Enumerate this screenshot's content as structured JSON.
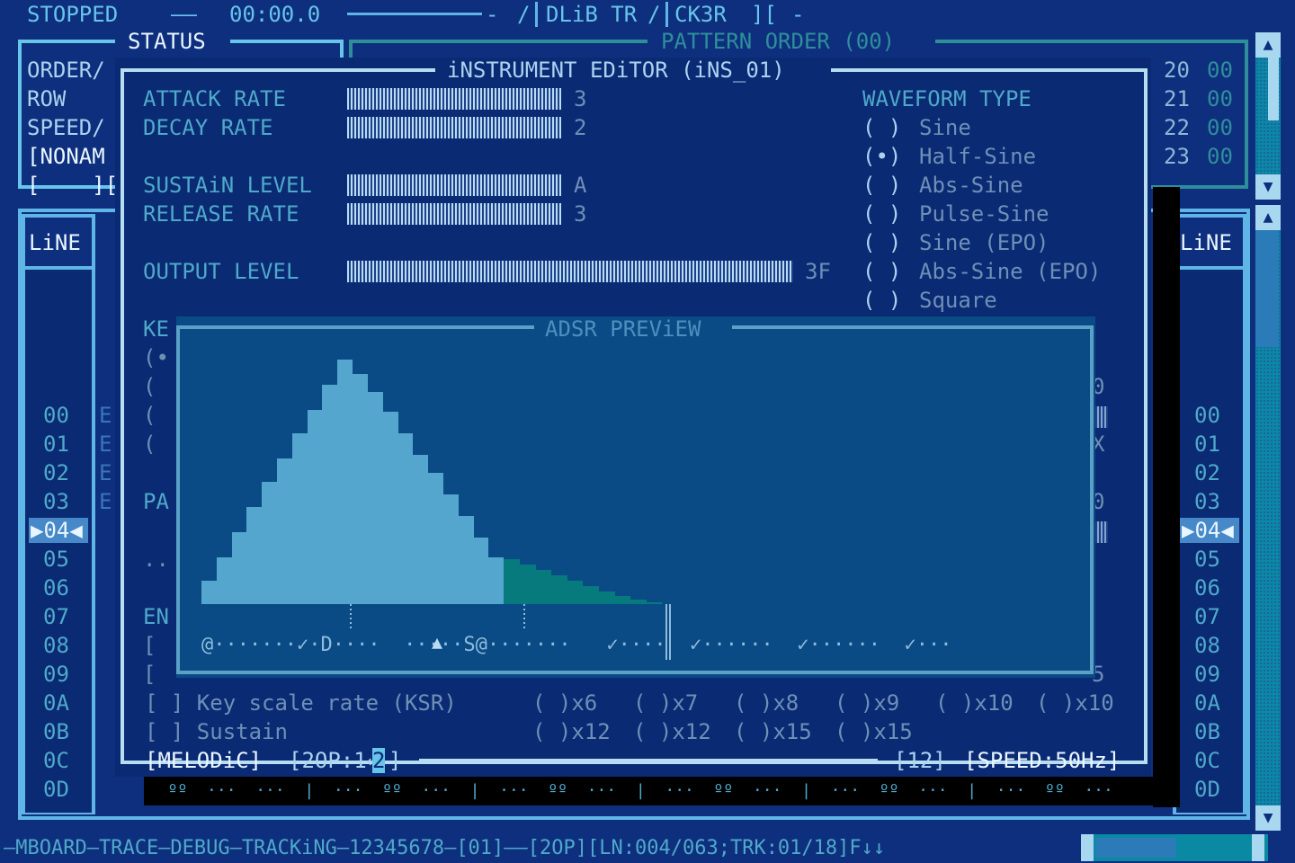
{
  "top_bar": {
    "status": "STOPPED",
    "dash1": "——",
    "time": "00:00.0",
    "dash2": "——————————",
    "app_title": "DLiB TR",
    "app_title2": "CK3R",
    "bracket": "][",
    "slash": "/",
    "slash2": "/",
    "dash_mid": "-",
    "dash_end": "-",
    "bar_left": "-",
    "bar_right": "|"
  },
  "status_panel": {
    "title": "STATUS",
    "rows": [
      "ORDER/",
      "ROW",
      "SPEED/",
      "[NONAM",
      "[    ]["
    ]
  },
  "pattern_order": {
    "title": "PATTERN ORDER (00)",
    "rows": [
      {
        "a": "20",
        "b": "00"
      },
      {
        "a": "21",
        "b": "00"
      },
      {
        "a": "22",
        "b": "00"
      },
      {
        "a": "23",
        "b": "00"
      }
    ]
  },
  "line_left": {
    "header": "LiNE",
    "rows": [
      "00",
      "01",
      "02",
      "03",
      "04",
      "05",
      "06",
      "07",
      "08",
      "09",
      "0A",
      "0B",
      "0C",
      "0D"
    ],
    "selected": "04",
    "selected_label": "▶04◀",
    "side_letters": [
      "E",
      "E",
      "E",
      "E"
    ]
  },
  "line_right": {
    "header": "LiNE",
    "rows": [
      "00",
      "01",
      "02",
      "03",
      "04",
      "05",
      "06",
      "07",
      "08",
      "09",
      "0A",
      "0B",
      "0C",
      "0D"
    ],
    "selected_label": "▶04◀"
  },
  "editor": {
    "title": "iNSTRUMENT EDiTOR (iNS_01)",
    "params": [
      {
        "label": "ATTACK RATE",
        "value": "3",
        "fill": 1.0
      },
      {
        "label": "DECAY RATE",
        "value": "2",
        "fill": 1.0
      },
      {
        "label": "SUSTAiN LEVEL",
        "value": "A",
        "fill": 1.0
      },
      {
        "label": "RELEASE RATE",
        "value": "3",
        "fill": 1.0
      },
      {
        "label": "OUTPUT LEVEL",
        "value": "3F",
        "fill": 1.0
      }
    ],
    "waveform": {
      "title": "WAVEFORM TYPE",
      "options": [
        {
          "mark": "( )",
          "label": "Sine"
        },
        {
          "mark": "(•)",
          "label": "Half-Sine"
        },
        {
          "mark": "( )",
          "label": "Abs-Sine"
        },
        {
          "mark": "( )",
          "label": "Pulse-Sine"
        },
        {
          "mark": "( )",
          "label": "Sine (EPO)"
        },
        {
          "mark": "( )",
          "label": "Abs-Sine (EPO)"
        },
        {
          "mark": "( )",
          "label": "Square"
        }
      ]
    },
    "hidden_labels": {
      "ke": "KE",
      "pa": "PA",
      "en": "EN",
      "radio1": "(•",
      "radio_paren": "(",
      "bracket": "[",
      "dots": "..",
      "right_0a": "0",
      "right_x": "X",
      "right_0b": "0",
      "right_5": "5"
    },
    "ksr_label": "[ ] Key scale rate (KSR)",
    "sustain_label": "[ ] Sustain",
    "multipliers_row1": [
      "( )x6",
      "( )x7",
      "( )x8",
      "( )x9",
      "( )x10",
      "( )x10"
    ],
    "multipliers_row2": [
      "( )x12",
      "( )x12",
      "( )x15",
      "( )x15"
    ],
    "footer": {
      "mode": "[MELODiC]",
      "op": "[2OP:1↔",
      "op_sel": "2",
      "op_end": "]",
      "num": "[12]",
      "speed": "[SPEED:50Hz]"
    }
  },
  "adsr": {
    "title": "ADSR PREViEW",
    "markers": "@·······✓·D····  ·····S@·······   ✓····  ✓······  ✓······  ✓···",
    "attack_peak_label": "▲"
  },
  "bottom_bar": {
    "text": "—MBOARD—TRACE—DEBUG—TRACKiNG—12345678—[01]——[2OP][LN:004/063;TRK:01/18]F↓↓"
  },
  "pattern_track_dots": "  ºº  ···  ···  |  ···  ºº  ···  |  ···  ºº  ···  |  ···  ºº  ···  |  ···  ºº  ···  |  ···  ºº  ···",
  "colors": {
    "bg": "#0e2f7e",
    "frame": "#5fb6e6",
    "teal_frame": "#2e8f9a",
    "attack_decay_fill": "#55a6cf",
    "release_fill": "#077a7e"
  }
}
